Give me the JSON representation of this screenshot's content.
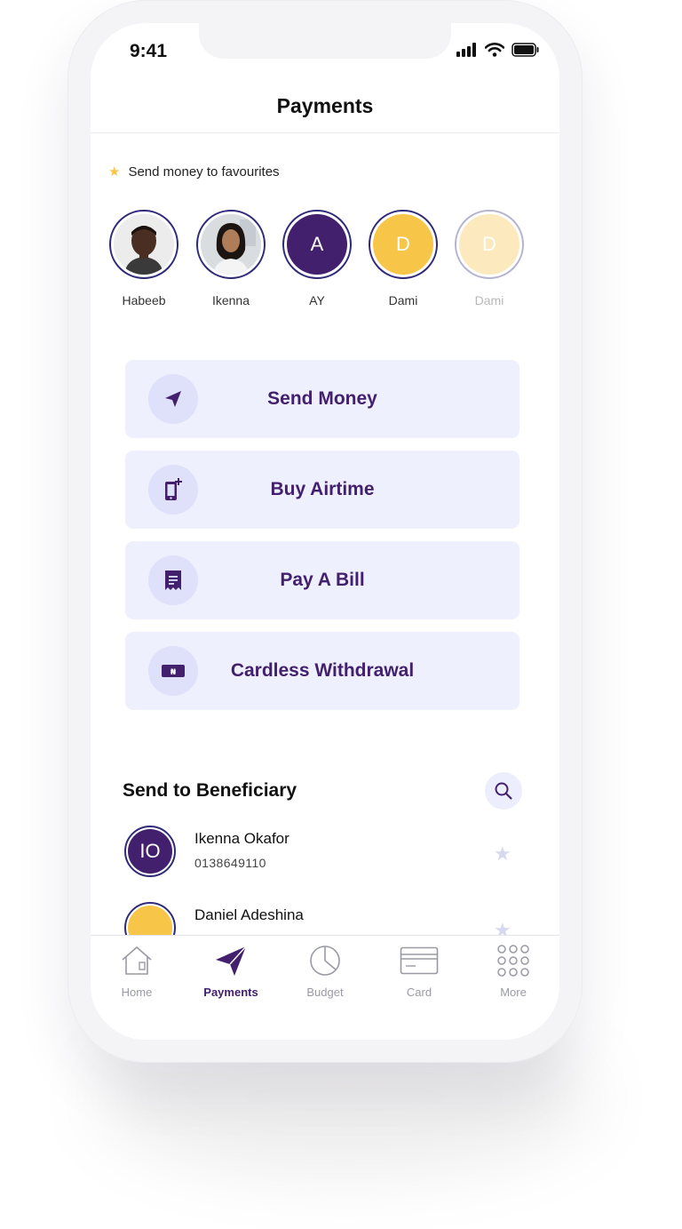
{
  "status_bar": {
    "time": "9:41"
  },
  "header": {
    "title": "Payments"
  },
  "favourites": {
    "label": "Send money to favourites",
    "items": [
      {
        "name": "Habeeb",
        "initial": ""
      },
      {
        "name": "Ikenna",
        "initial": ""
      },
      {
        "name": "AY",
        "initial": "A"
      },
      {
        "name": "Dami",
        "initial": "D"
      },
      {
        "name": "Dami",
        "initial": "D"
      }
    ]
  },
  "actions": [
    {
      "label": "Send Money",
      "icon": "send-arrow-icon"
    },
    {
      "label": "Buy Airtime",
      "icon": "phone-plus-icon"
    },
    {
      "label": "Pay A Bill",
      "icon": "receipt-icon"
    },
    {
      "label": "Cardless Withdrawal",
      "icon": "naira-card-icon"
    }
  ],
  "beneficiaries": {
    "title": "Send to Beneficiary",
    "items": [
      {
        "initials": "IO",
        "name": "Ikenna Okafor",
        "account": "0138649110"
      },
      {
        "initials": "",
        "name": "Daniel Adeshina",
        "account": ""
      }
    ]
  },
  "tabbar": {
    "items": [
      {
        "label": "Home",
        "icon": "home-icon"
      },
      {
        "label": "Payments",
        "icon": "send-arrow-icon"
      },
      {
        "label": "Budget",
        "icon": "pie-chart-icon"
      },
      {
        "label": "Card",
        "icon": "card-icon"
      },
      {
        "label": "More",
        "icon": "grid-dots-icon"
      }
    ],
    "active": "Payments"
  },
  "colors": {
    "brand_purple": "#42206e",
    "accent_yellow": "#f7c548",
    "action_background": "#eef0fe"
  }
}
